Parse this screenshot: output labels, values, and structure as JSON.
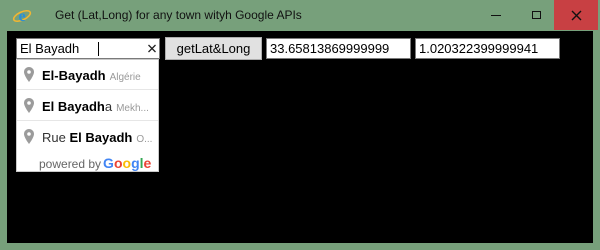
{
  "window": {
    "title": "Get (Lat,Long) for any town wityh Google APIs",
    "icon": "internet-explorer-icon"
  },
  "search": {
    "value": "El Bayadh",
    "clear_icon": "close-icon"
  },
  "button": {
    "label": "getLat&Long"
  },
  "results": {
    "lat": "33.65813869999999",
    "lng": "1.020322399999941"
  },
  "suggestions": [
    {
      "prefix": "",
      "match": "El-Bayadh",
      "suffix": "",
      "secondary": "Algérie"
    },
    {
      "prefix": "",
      "match": "El Bayadh",
      "suffix": "a",
      "secondary": "Mekh..."
    },
    {
      "prefix": "Rue ",
      "match": "El Bayadh",
      "suffix": "",
      "secondary": "O..."
    }
  ],
  "attribution": {
    "powered_by": "powered by",
    "logo": [
      "G",
      "o",
      "o",
      "g",
      "l",
      "e"
    ]
  },
  "colors": {
    "frame": "#77a07b",
    "close": "#c84043",
    "client_bg": "#000000",
    "google_blue": "#4285f4",
    "google_red": "#ea4335",
    "google_yellow": "#fbbc05",
    "google_green": "#34a853"
  }
}
